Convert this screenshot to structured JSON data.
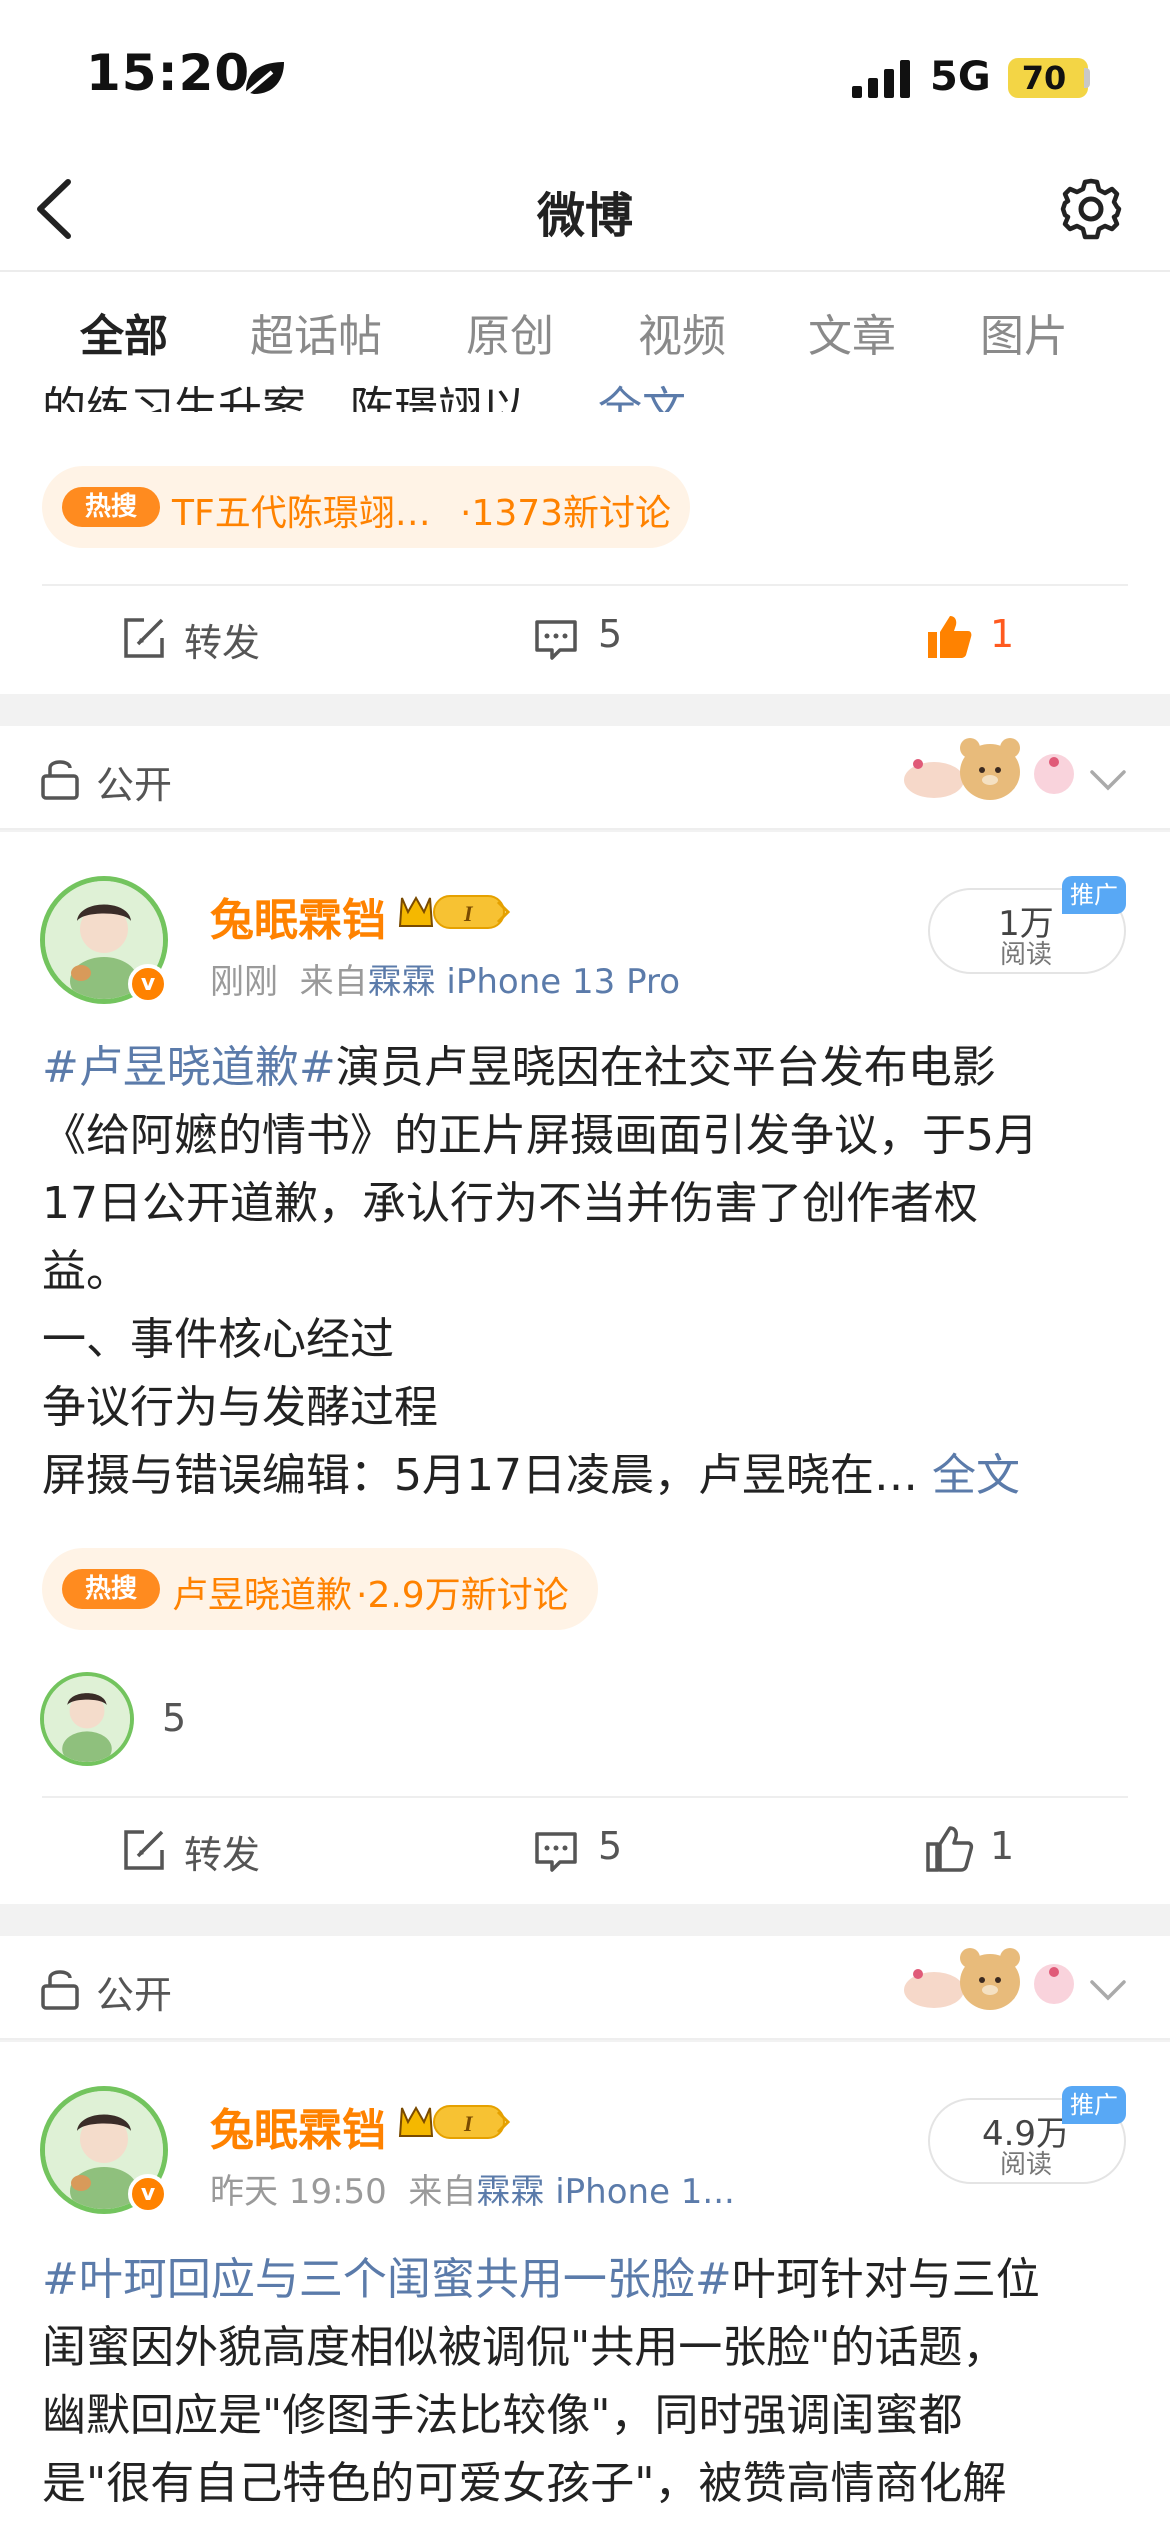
{
  "status_bar": {
    "time": "15:20",
    "network": "5G",
    "battery": "70"
  },
  "nav": {
    "title": "微博"
  },
  "tabs": [
    {
      "label": "全部",
      "active": true
    },
    {
      "label": "超话帖",
      "active": false
    },
    {
      "label": "原创",
      "active": false
    },
    {
      "label": "视频",
      "active": false
    },
    {
      "label": "文章",
      "active": false
    },
    {
      "label": "图片",
      "active": false
    }
  ],
  "post0": {
    "cut_text": "的练习生升案，陈璟翊以 … ",
    "full_label": "全文",
    "hot": {
      "badge": "热搜",
      "topic": "TF五代陈璟翊…",
      "count": "·1373新讨论"
    },
    "actions": {
      "repost": "转发",
      "comments": "5",
      "likes": "1"
    }
  },
  "post1": {
    "privacy": "公开",
    "user": {
      "name": "兔眠霖铛",
      "vip": "I"
    },
    "meta": {
      "time": "刚刚",
      "from": "来自",
      "source": "霖霖 iPhone 13 Pro"
    },
    "reads": {
      "count": "1万",
      "label": "阅读",
      "promo": "推广"
    },
    "body": {
      "topic": "#卢昱晓道歉#",
      "line1": "演员卢昱晓因在社交平台发布电影",
      "line2": "《给阿嬷的情书》的正片屏摄画面引发争议，于5月",
      "line3": "17日公开道歉，承认行为不当并伤害了创作者权",
      "line4": "益。",
      "line5": "一、事件核心经过",
      "line6": "争议行为与发酵过程",
      "line7": "屏摄与错误编辑：5月17日凌晨，卢昱晓在… ",
      "full": "全文"
    },
    "hot": {
      "badge": "热搜",
      "topic": "卢昱晓道歉",
      "count": "·2.9万新讨论"
    },
    "likers_count": "5",
    "actions": {
      "repost": "转发",
      "comments": "5",
      "likes": "1"
    }
  },
  "post2": {
    "privacy": "公开",
    "user": {
      "name": "兔眠霖铛",
      "vip": "I"
    },
    "meta": {
      "time": "昨天 19:50",
      "from": "来自",
      "source": "霖霖 iPhone 1..."
    },
    "reads": {
      "count": "4.9万",
      "label": "阅读",
      "promo": "推广"
    },
    "body": {
      "topic": "#叶珂回应与三个闺蜜共用一张脸#",
      "line1": "叶珂针对与三位",
      "line2": "闺蜜因外貌高度相似被调侃\"共用一张脸\"的话题，",
      "line3": "幽默回应是\"修图手法比较像\"，同时强调闺蜜都",
      "line4": "是\"很有自己特色的可爱女孩子\"，被赞高情商化解"
    }
  },
  "colors": {
    "accent": "#ff8200",
    "link": "#5b7baa",
    "promo": "#58a8f5",
    "battery": "#f3d545"
  },
  "icons": [
    "leaf-icon",
    "signal-icon",
    "back-icon",
    "gear-icon",
    "hot-search-icon",
    "repost-icon",
    "comment-icon",
    "like-icon",
    "lock-icon",
    "chevron-down-icon",
    "verified-icon",
    "vip-badge-icon"
  ]
}
